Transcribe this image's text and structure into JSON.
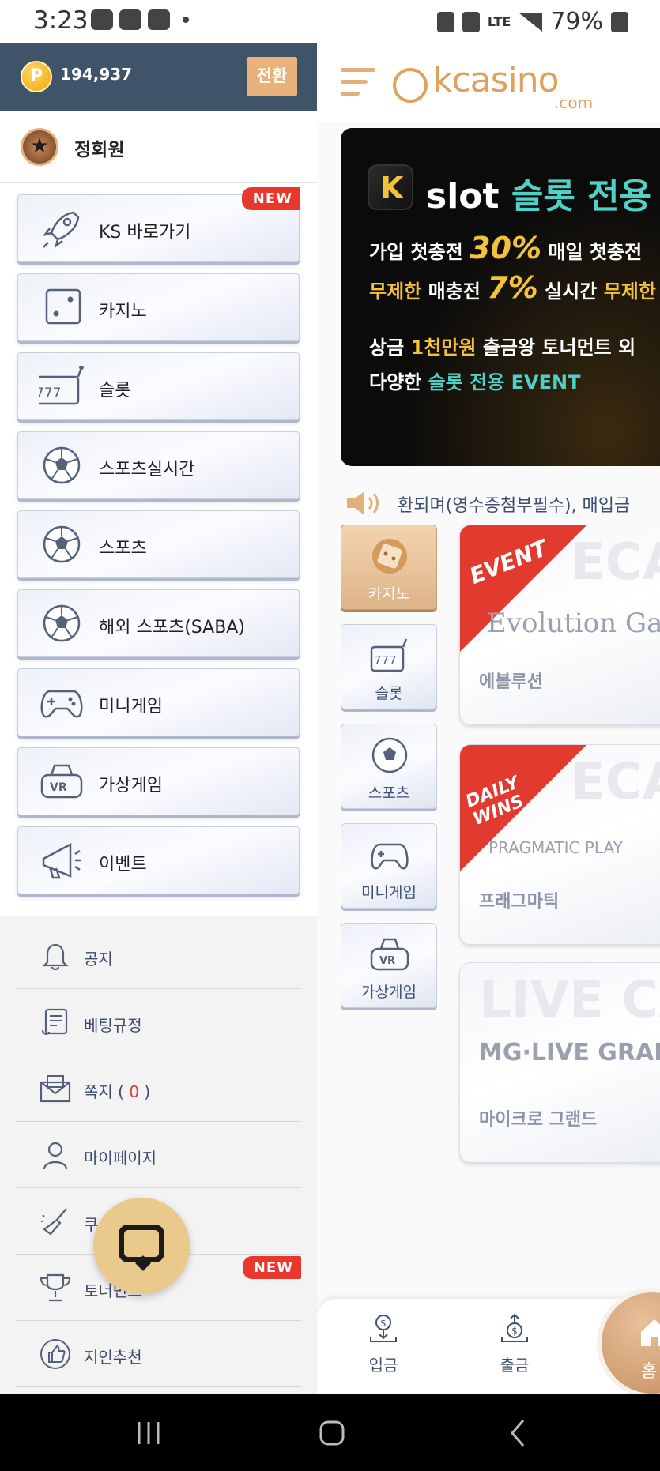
{
  "status_bar": {
    "time": "3:23",
    "network": "LTE",
    "battery": "79%"
  },
  "drawer": {
    "points": "194,937",
    "coin_symbol": "P",
    "switch_label": "전환",
    "member_label": "정회원",
    "game_items": [
      {
        "label": "KS 바로가기",
        "icon": "rocket-icon",
        "new": "NEW"
      },
      {
        "label": "카지노",
        "icon": "dice-icon"
      },
      {
        "label": "슬롯",
        "icon": "slot-machine-icon"
      },
      {
        "label": "스포츠실시간",
        "icon": "soccer-ball-icon"
      },
      {
        "label": "스포츠",
        "icon": "soccer-ball-icon"
      },
      {
        "label": "해외 스포츠(SABA)",
        "icon": "soccer-ball-icon"
      },
      {
        "label": "미니게임",
        "icon": "gamepad-icon"
      },
      {
        "label": "가상게임",
        "icon": "vr-headset-icon"
      },
      {
        "label": "이벤트",
        "icon": "megaphone-icon"
      }
    ],
    "info_items": [
      {
        "label": "공지",
        "icon": "bell-icon"
      },
      {
        "label": "베팅규정",
        "icon": "scroll-icon"
      },
      {
        "label": "쪽지",
        "count": "0",
        "icon": "envelope-icon"
      },
      {
        "label": "마이페이지",
        "icon": "user-icon"
      },
      {
        "label": "쿠",
        "icon": "broom-icon"
      },
      {
        "label": "토너먼트",
        "icon": "trophy-icon",
        "new": "NEW"
      },
      {
        "label": "지인추천",
        "icon": "thumbs-up-icon"
      }
    ]
  },
  "main": {
    "logo_text": "kcasino",
    "logo_sub": ".com",
    "banner": {
      "brand": "slot",
      "title": "슬롯 전용 혜",
      "line1_a": "가입 첫충전",
      "line1_pct": "30%",
      "line1_b": "매일 첫충전",
      "line2_a": "무제한",
      "line2_b": "매충전",
      "line2_pct": "7%",
      "line2_c": "실시간",
      "line2_d": "무제한",
      "line3_a": "상금",
      "line3_b": "1천만원",
      "line3_c": "출금왕 토너먼트 외",
      "line4_a": "다양한",
      "line4_b": "슬롯 전용 EVENT"
    },
    "notice_text": "환되며(영수증첨부필수), 매입금",
    "categories": [
      {
        "label": "카지노",
        "icon": "dice-icon",
        "active": true
      },
      {
        "label": "슬롯",
        "icon": "slot-machine-icon"
      },
      {
        "label": "스포츠",
        "icon": "soccer-ball-icon"
      },
      {
        "label": "미니게임",
        "icon": "gamepad-icon"
      },
      {
        "label": "가상게임",
        "icon": "vr-headset-icon"
      }
    ],
    "providers": [
      {
        "name": "에볼루션",
        "brand": "Evolution Gaming",
        "ribbon": "EVENT",
        "watermark": "ECAS"
      },
      {
        "name": "프래그마틱",
        "brand": "PRAGMATIC PLAY",
        "ribbon": "DAILY WINS",
        "watermark": "ECAS"
      },
      {
        "name": "마이크로 그랜드",
        "brand": "MG·LIVE GRAND",
        "watermark": "LIVE CAS"
      }
    ],
    "bottom_nav": {
      "deposit": "입금",
      "withdraw": "출금",
      "home": "홈"
    }
  },
  "colors": {
    "drawer_header": "#3f5468",
    "accent": "#e0a15e",
    "new_tag": "#e8372c",
    "text_blue": "#3d4f75"
  }
}
